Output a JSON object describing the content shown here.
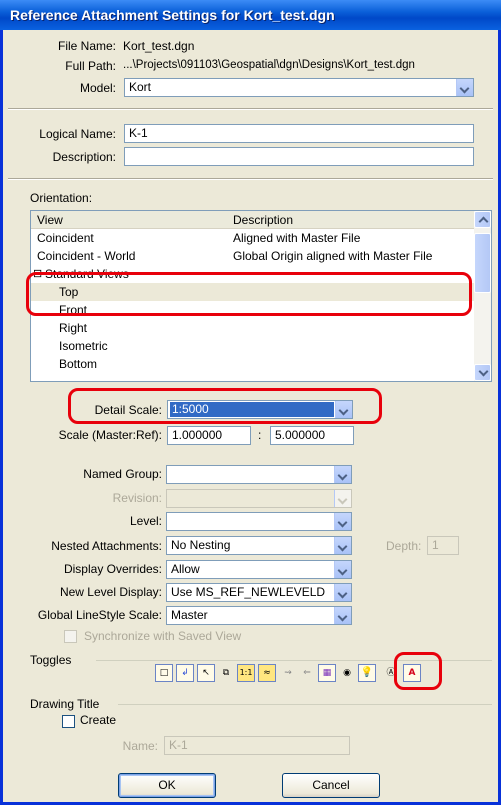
{
  "window": {
    "title": "Reference Attachment Settings for Kort_test.dgn"
  },
  "file": {
    "file_name_label": "File Name:",
    "file_name": "Kort_test.dgn",
    "full_path_label": "Full Path:",
    "full_path": "...\\Projects\\091103\\Geospatial\\dgn\\Designs\\Kort_test.dgn",
    "model_label": "Model:",
    "model": "Kort",
    "logical_name_label": "Logical Name:",
    "logical_name": "K-1",
    "description_label": "Description:",
    "description": ""
  },
  "orientation": {
    "label": "Orientation:",
    "columns": [
      "View",
      "Description"
    ],
    "rows": [
      {
        "view": "Coincident",
        "description": "Aligned with Master File"
      },
      {
        "view": "Coincident - World",
        "description": "Global Origin aligned with Master File"
      },
      {
        "view": "Standard Views",
        "description": ""
      },
      {
        "view": "Top",
        "description": ""
      },
      {
        "view": "Front",
        "description": ""
      },
      {
        "view": "Right",
        "description": ""
      },
      {
        "view": "Isometric",
        "description": ""
      },
      {
        "view": "Bottom",
        "description": ""
      }
    ],
    "tree_toggle": "⊟"
  },
  "scale": {
    "detail_scale_label": "Detail Scale:",
    "detail_scale": "1:5000",
    "scale_label": "Scale (Master:Ref):",
    "master": "1.000000",
    "colon": ":",
    "ref": "5.000000"
  },
  "settings": {
    "named_group_label": "Named Group:",
    "named_group": "",
    "revision_label": "Revision:",
    "revision": "",
    "level_label": "Level:",
    "level": "",
    "nested_label": "Nested Attachments:",
    "nested": "No Nesting",
    "depth_label": "Depth:",
    "depth": "1",
    "display_overrides_label": "Display Overrides:",
    "display_overrides": "Allow",
    "new_level_display_label": "New Level Display:",
    "new_level_display": "Use MS_REF_NEWLEVELD",
    "global_linestyle_label": "Global LineStyle Scale:",
    "global_linestyle": "Master",
    "sync_label": "Synchronize with Saved View"
  },
  "toggles": {
    "label": "Toggles",
    "icons": [
      "display-icon",
      "snap-icon",
      "locate-icon",
      "clip-icon",
      "true-scale-icon",
      "scale-linestyle-icon",
      "ignore-attachment-icon",
      "treat-as-element-icon",
      "raster-icon",
      "drawing-title-icon",
      "lighting-icon",
      "annotation-scale-icon",
      "linestyle-scale-icon"
    ],
    "glyphs": [
      "□",
      "↲",
      "↖",
      "⧉",
      "1:1",
      "≈",
      "⇝",
      "⇐",
      "▦",
      "◉",
      "💡",
      "Ⓐ",
      "A"
    ]
  },
  "drawing_title": {
    "label": "Drawing Title",
    "create_label": "Create",
    "name_label": "Name:",
    "name": "K-1"
  },
  "buttons": {
    "ok": "OK",
    "cancel": "Cancel"
  },
  "colors": {
    "title_bar": "#0a5fd8",
    "highlight": "#e8000b",
    "selection": "#316ac5"
  }
}
